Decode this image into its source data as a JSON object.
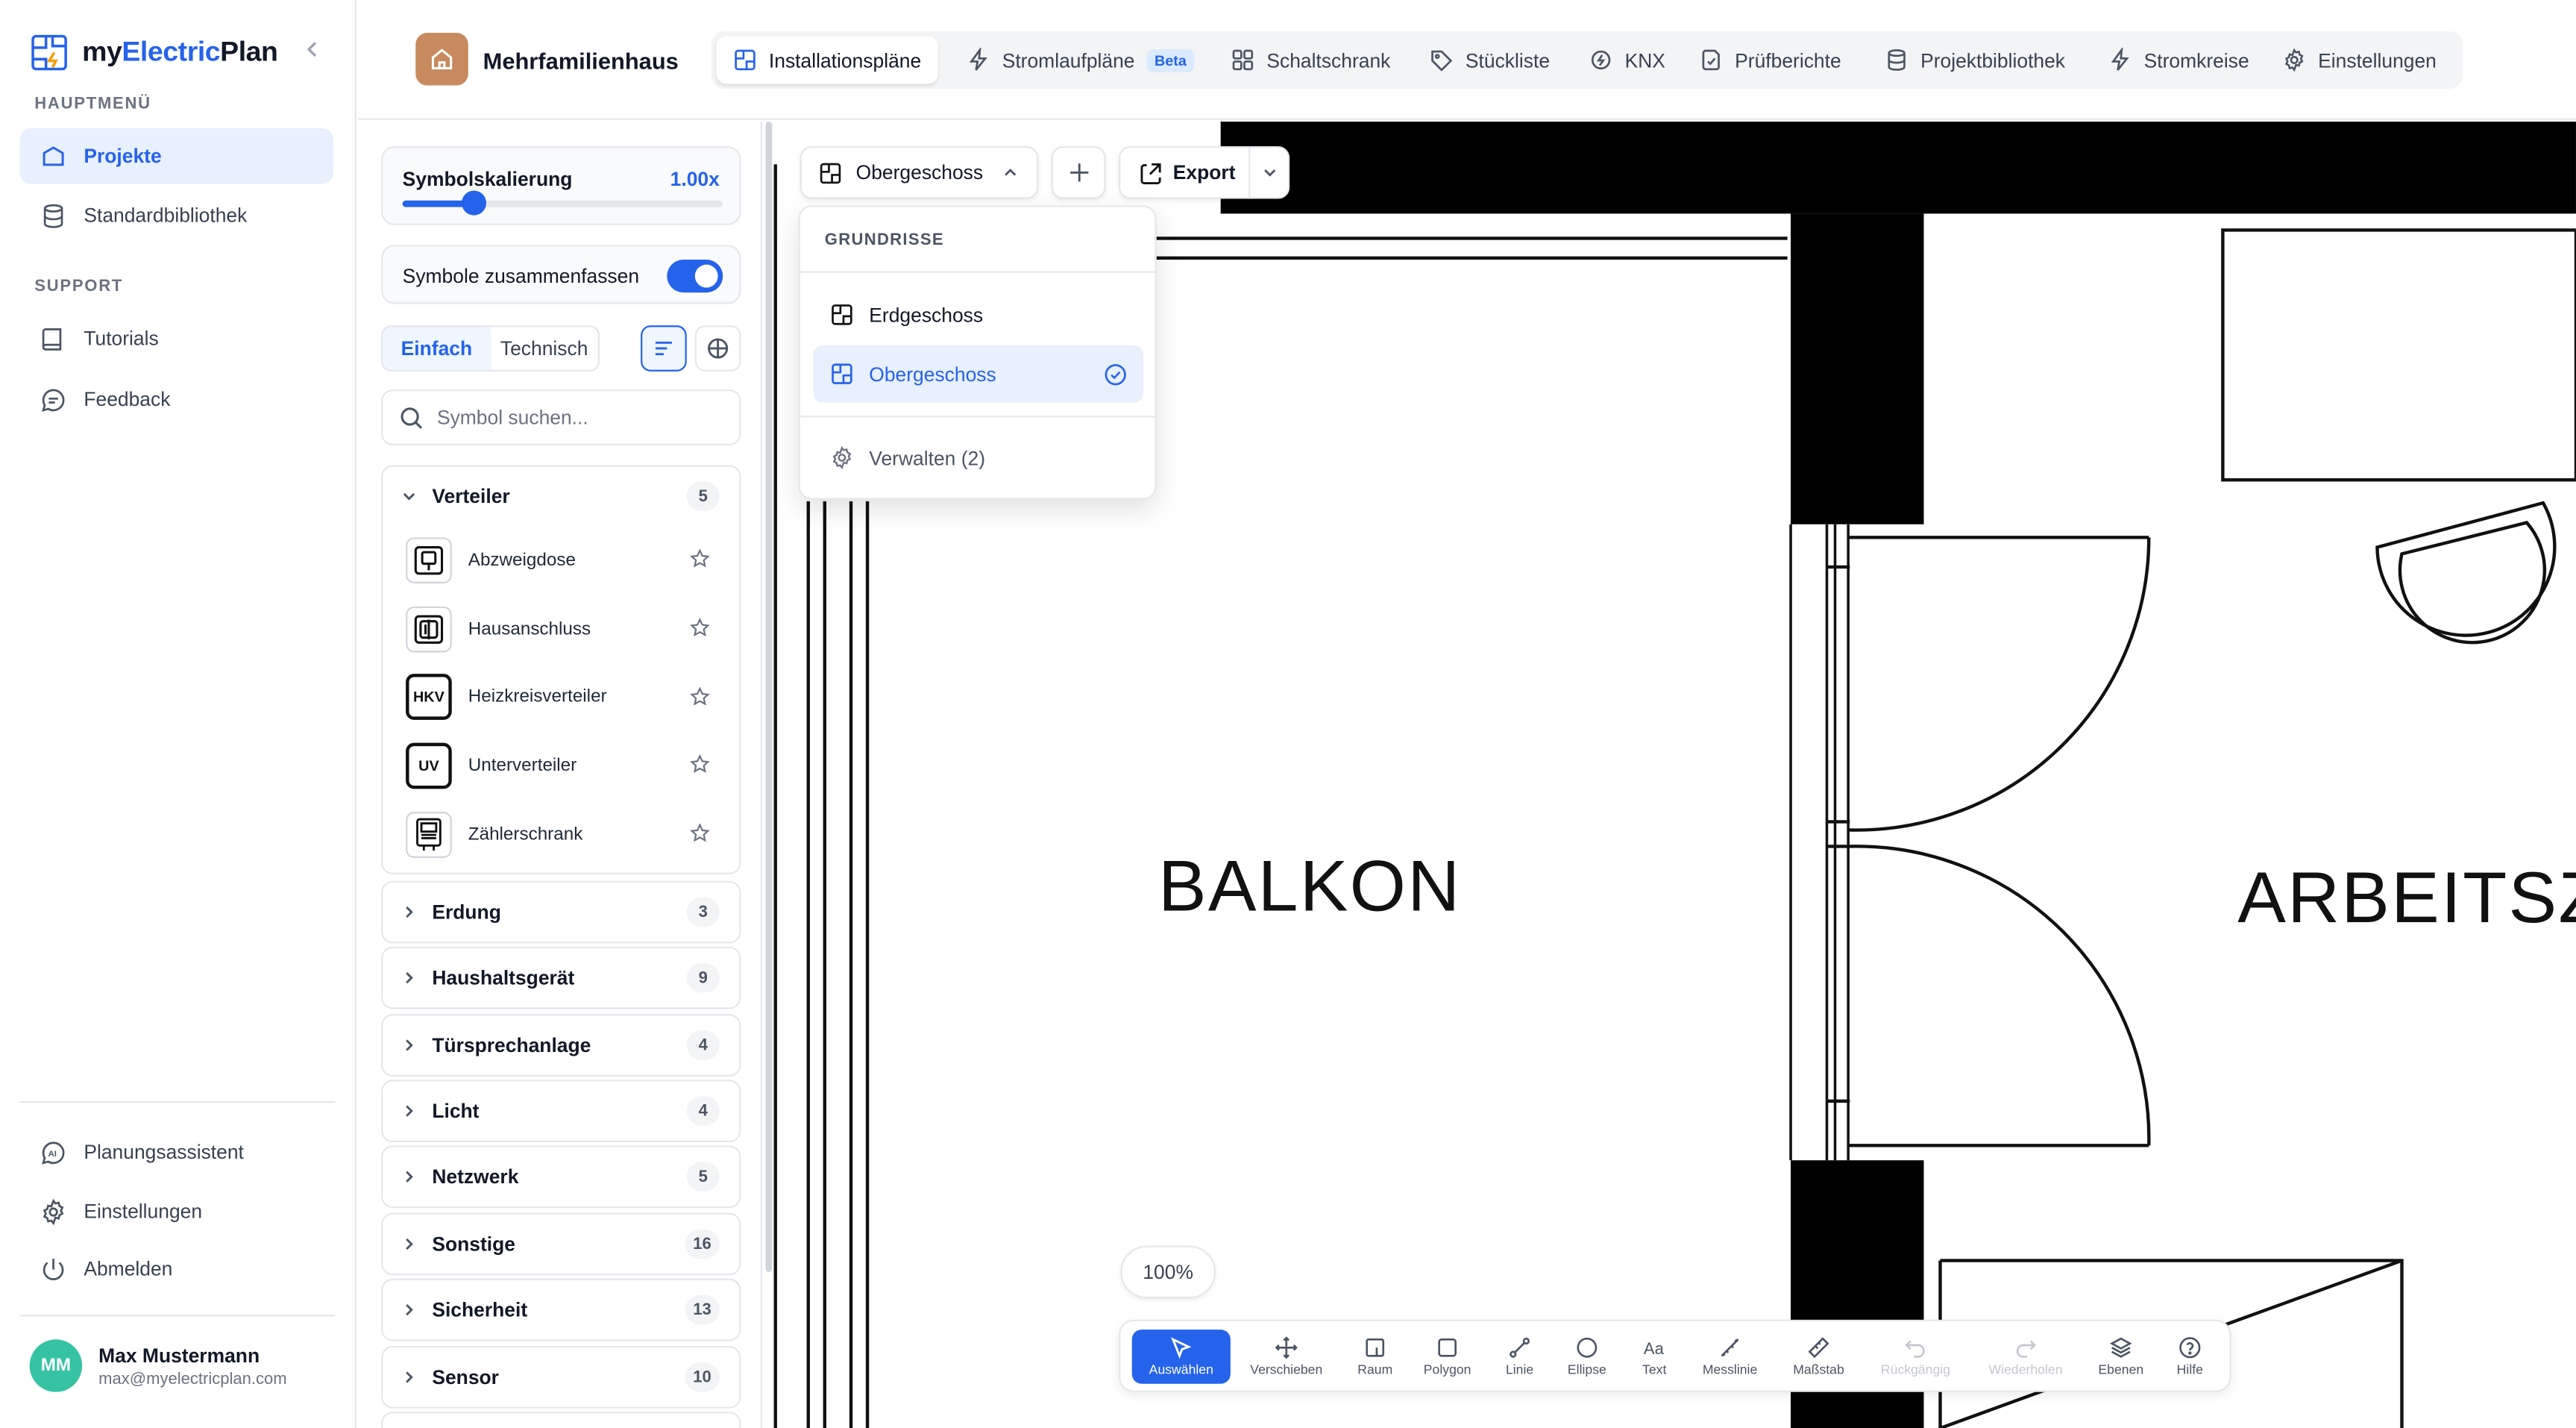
{
  "app": {
    "name_part1": "my",
    "name_part2": "Electric",
    "name_part3": "Plan"
  },
  "sidebar": {
    "main_heading": "HAUPTMENÜ",
    "main_items": [
      {
        "label": "Projekte",
        "icon": "folder-icon",
        "active": true
      },
      {
        "label": "Standardbibliothek",
        "icon": "database-icon"
      }
    ],
    "support_heading": "SUPPORT",
    "support_items": [
      {
        "label": "Tutorials",
        "icon": "book-icon"
      },
      {
        "label": "Feedback",
        "icon": "message-icon"
      }
    ],
    "bottom_items": [
      {
        "label": "Planungsassistent",
        "icon": "ai-icon"
      },
      {
        "label": "Einstellungen",
        "icon": "gear-icon"
      },
      {
        "label": "Abmelden",
        "icon": "power-icon"
      }
    ],
    "user": {
      "initials": "MM",
      "name": "Max Mustermann",
      "email": "max@myelectricplan.com"
    }
  },
  "header": {
    "project_name": "Mehrfamilienhaus",
    "tabs": [
      {
        "label": "Installationspläne",
        "active": true
      },
      {
        "label": "Stromlaufpläne",
        "badge": "Beta"
      },
      {
        "label": "Schaltschrank"
      },
      {
        "label": "Stückliste"
      },
      {
        "label": "KNX"
      },
      {
        "label": "Prüfberichte"
      },
      {
        "label": "Projektbibliothek"
      },
      {
        "label": "Stromkreise"
      },
      {
        "label": "Einstellungen"
      }
    ]
  },
  "panel": {
    "scale_label": "Symbolskalierung",
    "scale_value": "1.00x",
    "scale_fraction": 0.22,
    "combine_label": "Symbole zusammenfassen",
    "combine_on": true,
    "mode_simple": "Einfach",
    "mode_technical": "Technisch",
    "search_placeholder": "Symbol suchen...",
    "groups": [
      {
        "name": "Verteiler",
        "count": "5",
        "expanded": true,
        "items": [
          {
            "label": "Abzweigdose",
            "symbol": "junction-box-icon"
          },
          {
            "label": "Hausanschluss",
            "symbol": "house-connection-icon"
          },
          {
            "label": "Heizkreisverteiler",
            "symbol": "HKV"
          },
          {
            "label": "Unterverteiler",
            "symbol": "UV"
          },
          {
            "label": "Zählerschrank",
            "symbol": "meter-cabinet-icon"
          }
        ]
      },
      {
        "name": "Erdung",
        "count": "3"
      },
      {
        "name": "Haushaltsgerät",
        "count": "9"
      },
      {
        "name": "Türsprechanlage",
        "count": "4"
      },
      {
        "name": "Licht",
        "count": "4"
      },
      {
        "name": "Netzwerk",
        "count": "5"
      },
      {
        "name": "Sonstige",
        "count": "16"
      },
      {
        "name": "Sicherheit",
        "count": "13"
      },
      {
        "name": "Sensor",
        "count": "10"
      }
    ]
  },
  "canvas": {
    "floor_select": "Obergeschoss",
    "export_label": "Export",
    "dropdown": {
      "heading": "GRUNDRISSE",
      "options": [
        "Erdgeschoss",
        "Obergeschoss"
      ],
      "selected": "Obergeschoss",
      "manage": "Verwalten (2)"
    },
    "rooms": [
      "BALKON",
      "ARBEITSZI"
    ],
    "zoom": "100%",
    "tools": [
      {
        "label": "Auswählen",
        "active": true
      },
      {
        "label": "Verschieben"
      },
      {
        "label": "Raum"
      },
      {
        "label": "Polygon"
      },
      {
        "label": "Linie"
      },
      {
        "label": "Ellipse"
      },
      {
        "label": "Text"
      },
      {
        "label": "Messlinie"
      },
      {
        "label": "Maßstab"
      },
      {
        "label": "Rückgängig",
        "disabled": true
      },
      {
        "label": "Wiederholen",
        "disabled": true
      },
      {
        "label": "Ebenen"
      },
      {
        "label": "Hilfe"
      }
    ]
  },
  "colors": {
    "accent": "#2563eb",
    "accent_bg": "#e8effd",
    "avatar": "#36c3a4",
    "project_icon": "#c88a5e"
  }
}
